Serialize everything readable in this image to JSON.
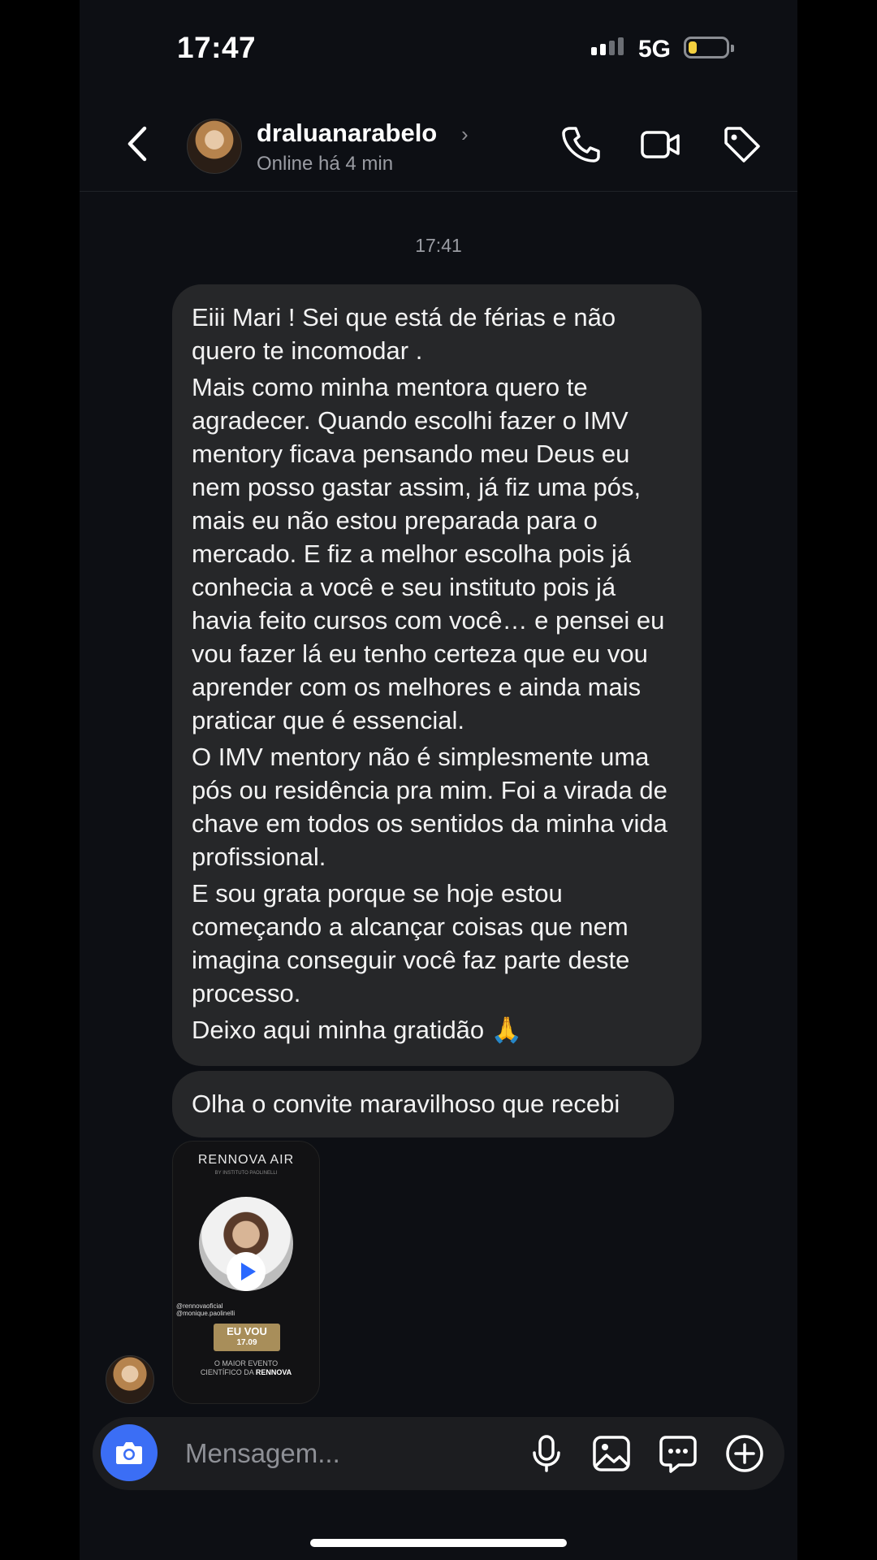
{
  "status_bar": {
    "time": "17:47",
    "network": "5G"
  },
  "header": {
    "username": "draluanarabelo",
    "status": "Online há 4 min"
  },
  "conversation": {
    "timestamp": "17:41",
    "message1_paragraphs": [
      "Eiii Mari ! Sei que está de férias e não quero te incomodar .",
      "Mais como minha mentora quero te agradecer.  Quando escolhi fazer o IMV mentory ficava pensando meu Deus eu nem posso gastar assim, já fiz uma pós, mais eu não estou preparada para o mercado. E  fiz a melhor escolha pois já conhecia a você e seu instituto pois já havia feito cursos com você… e pensei eu vou fazer lá eu tenho certeza que eu vou aprender com os melhores e ainda mais praticar que é essencial.",
      "O IMV mentory não é simplesmente uma pós ou residência pra mim. Foi a virada de chave em todos os sentidos da minha vida profissional.",
      "E sou grata porque se hoje estou começando a alcançar coisas que nem imagina conseguir você faz parte deste processo.",
      "Deixo aqui minha gratidão 🙏"
    ],
    "message2": "Olha o convite maravilhoso que recebi",
    "media": {
      "logo": "RENNOVA AIR",
      "logo_sub": "BY INSTITUTO PAOLINELLI",
      "tags": [
        "@rennovaoficial",
        "@monique.paolinelli"
      ],
      "ticket_line1": "EU VOU",
      "ticket_line2": "17.09",
      "footer_line1": "O MAIOR EVENTO",
      "footer_line2_prefix": "CIENTÍFICO DA",
      "footer_line2_brand": "RENNOVA"
    }
  },
  "composer": {
    "placeholder": "Mensagem..."
  },
  "colors": {
    "camera_button": "#3b6ef5",
    "bubble": "#262729",
    "background": "#0d0f14"
  },
  "icons": [
    "back-icon",
    "chevron-right-icon",
    "phone-icon",
    "video-icon",
    "tag-icon",
    "camera-icon",
    "microphone-icon",
    "gallery-icon",
    "sticker-icon",
    "add-icon",
    "play-icon"
  ]
}
